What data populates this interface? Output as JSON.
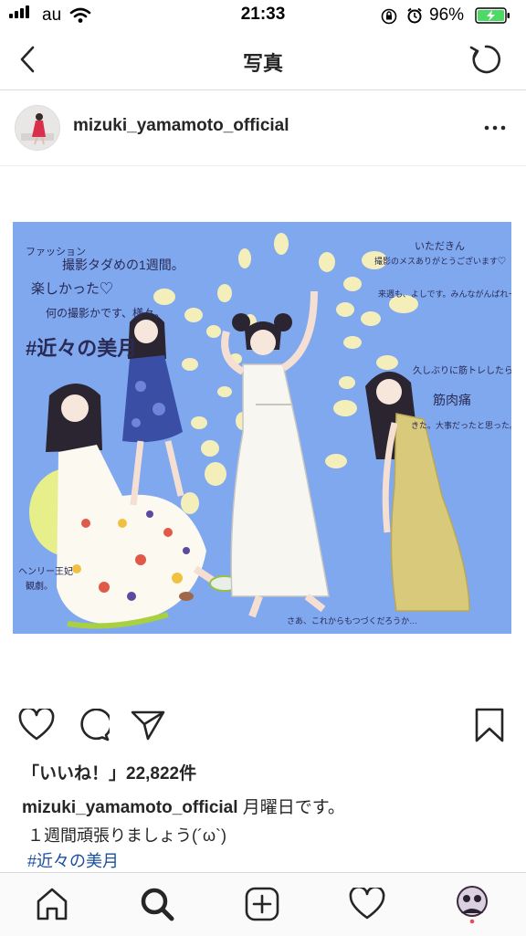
{
  "status_bar": {
    "carrier": "au",
    "time": "21:33",
    "battery_percent": "96%",
    "wifi_icon": "wifi-icon",
    "lock_icon": "orientation-lock-icon",
    "alarm_icon": "alarm-icon",
    "battery_icon": "battery-charging-icon"
  },
  "nav": {
    "title": "写真",
    "back_icon": "chevron-left-icon",
    "refresh_icon": "refresh-icon"
  },
  "post": {
    "username": "mizuki_yamamoto_official",
    "more_icon": "more-horizontal-icon",
    "likes_text": "「いいね！」22,822件",
    "caption_user": "mizuki_yamamoto_official",
    "caption_text": " 月曜日です。",
    "caption_line2": "１週間頑張りましょう(´ω`)",
    "hashtag": "#近々の美月",
    "illustration": {
      "background": "#7fa8ee",
      "texts": {
        "t1": "ファッション",
        "t2": "撮影タダめの1週間。",
        "t3": "楽しかった♡",
        "t4": "何の撮影かです、様々。",
        "t5": "#近々の美月",
        "t6": "いただきん",
        "t7": "撮影のメスありがとうございます♡",
        "t8": "来週も、よしです。みんながんばれー！",
        "t9": "久しぶりに筋トレしたら、",
        "t10": "筋肉痛",
        "t11": "きた。大事だったと思った。",
        "t12": "さあ、これからもつづくだろうか…",
        "t13": "ヘンリー王妃",
        "t14": "観劇。"
      }
    }
  },
  "actions": {
    "like_icon": "heart-icon",
    "comment_icon": "comment-icon",
    "share_icon": "share-icon",
    "save_icon": "bookmark-icon"
  },
  "tabbar": {
    "home_icon": "home-icon",
    "search_icon": "search-icon",
    "add_icon": "add-post-icon",
    "activity_icon": "activity-heart-icon",
    "profile_icon": "profile-avatar"
  }
}
